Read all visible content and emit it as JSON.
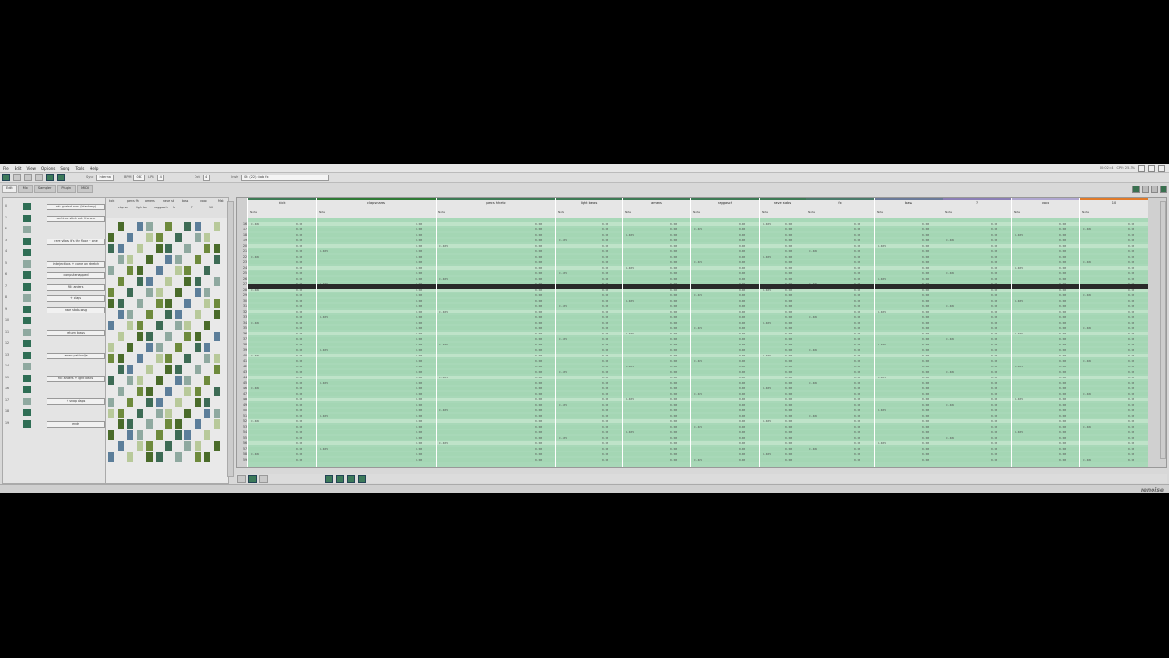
{
  "menu": [
    "File",
    "Edit",
    "View",
    "Options",
    "Song",
    "Tools",
    "Help"
  ],
  "toolbar": {
    "sync_label": "Sync",
    "sync_value": "Internal",
    "bpm_label": "BPM",
    "bpm_value": "087",
    "lpb_label": "LPB",
    "lpb_value": "4",
    "oct_label": "Oct",
    "oct_value": "4",
    "instr_label": "Instr",
    "instr_value": "0F: (22) stab fx",
    "clock": "00:02:44",
    "cpu": "CPU: 25.3%"
  },
  "tabs": [
    "Edit",
    "Mix",
    "Sampler",
    "Plugin",
    "MIDI"
  ],
  "sequence": [
    {
      "num": "0",
      "name": "cut: gustnd rvrrs (black my)"
    },
    {
      "num": "1",
      "name": "continue stick out: the one"
    },
    {
      "num": "2",
      "name": ""
    },
    {
      "num": "3",
      "name": "rave vibes it's the floor + one"
    },
    {
      "num": "4",
      "name": ""
    },
    {
      "num": "5",
      "name": "interjections + come on stretch"
    },
    {
      "num": "6",
      "name": "computerzapped"
    },
    {
      "num": "7",
      "name": "fill: anders"
    },
    {
      "num": "8",
      "name": "+ claps"
    },
    {
      "num": "9",
      "name": "rave stabs.wsg"
    },
    {
      "num": "10",
      "name": ""
    },
    {
      "num": "11",
      "name": "return basss"
    },
    {
      "num": "12",
      "name": ""
    },
    {
      "num": "13",
      "name": "amen patrioolje"
    },
    {
      "num": "14",
      "name": ""
    },
    {
      "num": "15",
      "name": "fill: anders + light beats"
    },
    {
      "num": "16",
      "name": ""
    },
    {
      "num": "17",
      "name": "+ snap claps"
    },
    {
      "num": "18",
      "name": ""
    },
    {
      "num": "19",
      "name": "ends"
    }
  ],
  "matrix_headers": [
    "kick",
    "clap sn",
    "percs fh",
    "light be",
    "amens",
    "raggasch",
    "rave st",
    "fx",
    "bass",
    "?",
    "voco",
    "10",
    "Mst"
  ],
  "tracks": [
    {
      "name": "kick",
      "color": "#3d7a55"
    },
    {
      "name": "clap snares",
      "color": "#2f7a35"
    },
    {
      "name": "percs hh etc",
      "color": "#3d7a55"
    },
    {
      "name": "light beats",
      "color": "#3d7a55"
    },
    {
      "name": "amens",
      "color": "#3d7a55"
    },
    {
      "name": "raggasch",
      "color": "#3d7a55"
    },
    {
      "name": "rave stabs",
      "color": "#3d7a55"
    },
    {
      "name": "fx",
      "color": "#4a7a6a"
    },
    {
      "name": "bass",
      "color": "#6b7a99"
    },
    {
      "name": "?",
      "color": "#8b7fb5"
    },
    {
      "name": "voco",
      "color": "#b0a7d0"
    },
    {
      "name": "10",
      "color": "#e07a2a"
    }
  ],
  "note_header": "Note",
  "cell_sample": {
    "a": "C-405",
    "b": "C-41C",
    "c": "0.00",
    "d": "D-416",
    "e": "OFF",
    "f": "A#07"
  },
  "line_start": 16,
  "logo": "renoise"
}
